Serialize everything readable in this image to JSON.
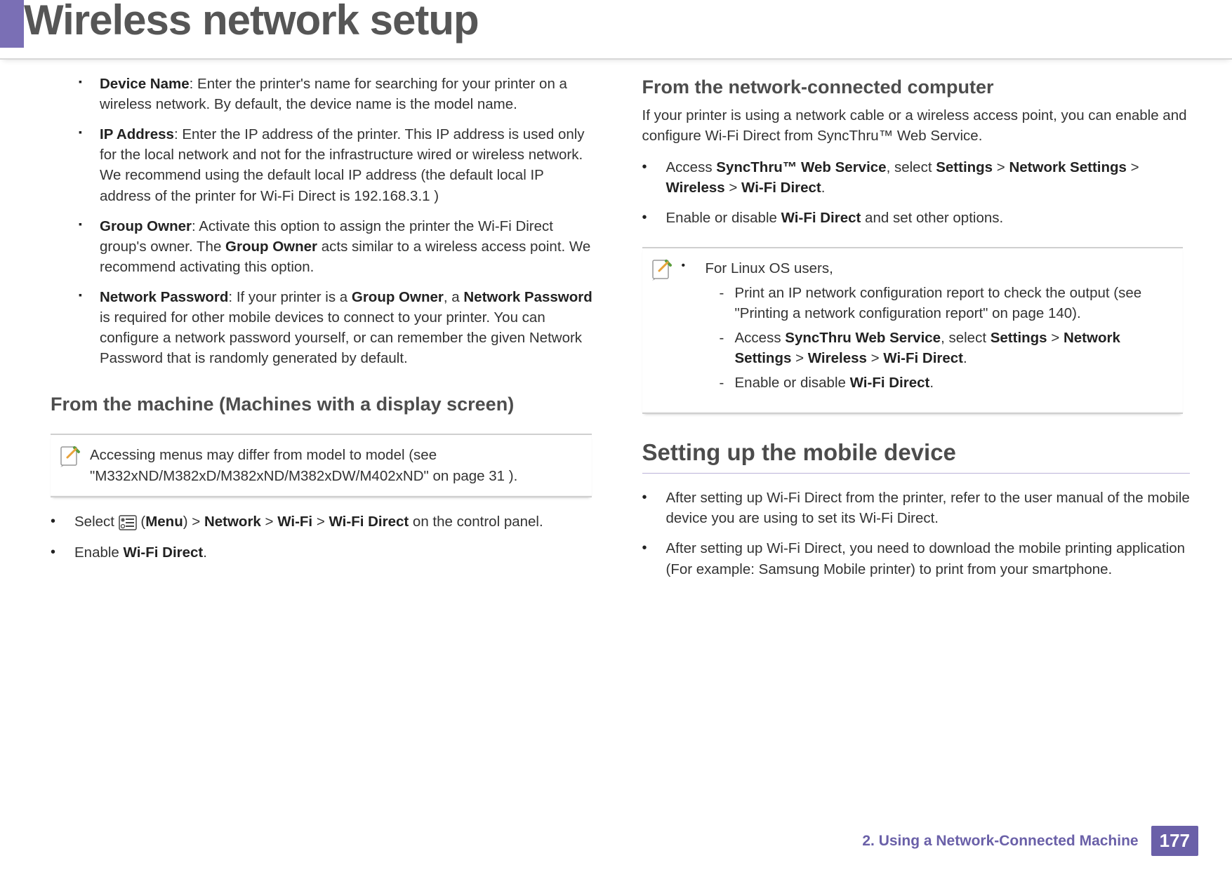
{
  "page": {
    "title": "Wireless network setup",
    "chapter_footer": "2.  Using a Network-Connected Machine",
    "page_number": "177"
  },
  "left": {
    "items": [
      {
        "label": "Device Name",
        "text": ": Enter the printer's name for searching for your printer on a wireless network. By default, the device name is the model name."
      },
      {
        "label": "IP Address",
        "text": ": Enter the IP address of the printer. This IP address is used only for the local network and not for the infrastructure wired or wireless network. We recommend using the default local IP address (the default local IP address of the printer for Wi-Fi Direct is 192.168.3.1 )"
      },
      {
        "label": "Group Owner",
        "text_pre": ": Activate this option to assign the printer the Wi-Fi Direct group's owner. The ",
        "bold1": "Group Owner",
        "text_post": " acts similar to a wireless access point. We recommend activating this option."
      },
      {
        "label": "Network Password",
        "text_pre": ": If your printer is a ",
        "bold1": "Group Owner",
        "mid": ", a ",
        "bold2": "Network Password",
        "text_post": " is required for other mobile devices to connect to your printer. You can configure a network password yourself, or can remember the given Network Password that is randomly generated by default."
      }
    ],
    "section_heading": "From the machine (Machines with a display screen)",
    "note": "Accessing menus may differ from model to model (see \"M332xND/M382xD/M382xND/M382xDW/M402xND\" on page 31 ).",
    "steps": {
      "s1_pre": "Select ",
      "s1_menu": "Menu",
      "s1_nw": "Network",
      "s1_wifi": "Wi-Fi",
      "s1_wfd": "Wi-Fi Direct",
      "s1_post": " on the control panel.",
      "s2_pre": "Enable ",
      "s2_bold": "Wi-Fi Direct",
      "s2_post": "."
    }
  },
  "right": {
    "section_heading": "From the network-connected computer",
    "intro": "If your printer is using a network cable or a wireless access point, you can enable and configure Wi-Fi Direct from SyncThru™ Web Service.",
    "steps": {
      "s1_pre": "Access ",
      "s1_b1": "SyncThru™ Web Service",
      "s1_mid1": ", select ",
      "s1_b2": "Settings",
      "s1_b3": "Network Settings",
      "s1_b4": "Wireless",
      "s1_b5": "Wi-Fi Direct",
      "s1_post": ".",
      "s2_pre": "Enable or disable ",
      "s2_b": "Wi-Fi Direct",
      "s2_post": " and set other options."
    },
    "note_linux": {
      "head": "For Linux OS users,",
      "d1": "Print an IP network configuration report to check the output (see \"Printing a network configuration report\" on page 140).",
      "d2_pre": "Access ",
      "d2_b1": "SyncThru Web Service",
      "d2_mid": ", select ",
      "d2_b2": "Settings",
      "d2_b3": "Network Settings",
      "d2_b4": "Wireless",
      "d2_b5": "Wi-Fi Direct",
      "d2_post": ".",
      "d3_pre": "Enable or disable ",
      "d3_b": "Wi-Fi Direct",
      "d3_post": "."
    },
    "big_heading": "Setting up the mobile device",
    "mobile": {
      "m1": "After setting up Wi-Fi Direct from the printer, refer to the user manual of the mobile device you are using to set its Wi-Fi Direct.",
      "m2": "After setting up Wi-Fi Direct, you need to download the mobile printing application (For example: Samsung Mobile printer) to print from your smartphone."
    }
  }
}
